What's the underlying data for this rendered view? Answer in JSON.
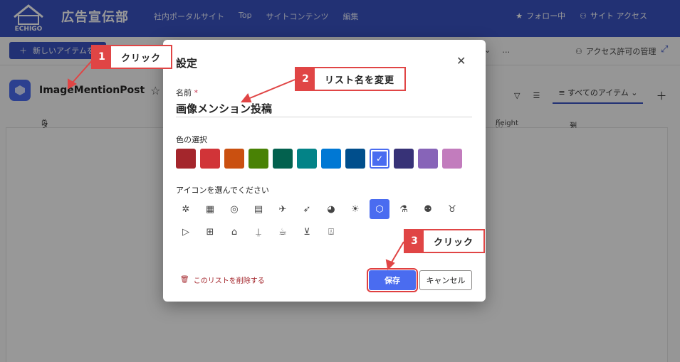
{
  "header": {
    "logo_text": "ECHIGO",
    "site_title": "広告宣伝部",
    "nav": [
      "社内ポータルサイト",
      "Top",
      "サイトコンテンツ",
      "編集"
    ],
    "follow": "フォロー中",
    "site_access": "サイト アクセス"
  },
  "commandbar": {
    "new_item": "新しいアイテムを追加",
    "more": "…",
    "access_mgmt": "アクセス許可の管理"
  },
  "list": {
    "name": "ImageMentionPost",
    "view_name": "すべてのアイテム",
    "columns": {
      "title": "タイトル",
      "height": "height",
      "add_column": "列の追加"
    }
  },
  "dialog": {
    "title": "設定",
    "name_label": "名前",
    "required_mark": "*",
    "name_value": "画像メンション投稿",
    "color_label": "色の選択",
    "colors": [
      "#a4262c",
      "#d13438",
      "#ca5010",
      "#498205",
      "#03614e",
      "#038387",
      "#0078d4",
      "#004e8c",
      "#4a6cf0",
      "#373277",
      "#8764b8",
      "#c27cbd"
    ],
    "selected_color_index": 8,
    "icon_label": "アイコンを選んでください",
    "icons_row1": [
      "bug-icon",
      "calendar-icon",
      "target-icon",
      "clipboard-icon",
      "airplane-icon",
      "rocket-icon",
      "palette-icon",
      "lightbulb-icon",
      "cube-icon",
      "beaker-icon",
      "robot-icon",
      "piggy-bank-icon"
    ],
    "icons_row2": [
      "play-icon",
      "medical-bag-icon",
      "bank-icon",
      "joystick-icon",
      "coffee-icon",
      "cart-icon",
      "cake-icon"
    ],
    "selected_icon": "cube-icon",
    "delete_label": "このリストを削除する",
    "save_label": "保存",
    "cancel_label": "キャンセル"
  },
  "annotations": [
    {
      "num": "1",
      "text": "クリック"
    },
    {
      "num": "2",
      "text": "リスト名を変更"
    },
    {
      "num": "3",
      "text": "クリック"
    }
  ],
  "accent_color": "#3a53c1",
  "annotation_color": "#e04545"
}
